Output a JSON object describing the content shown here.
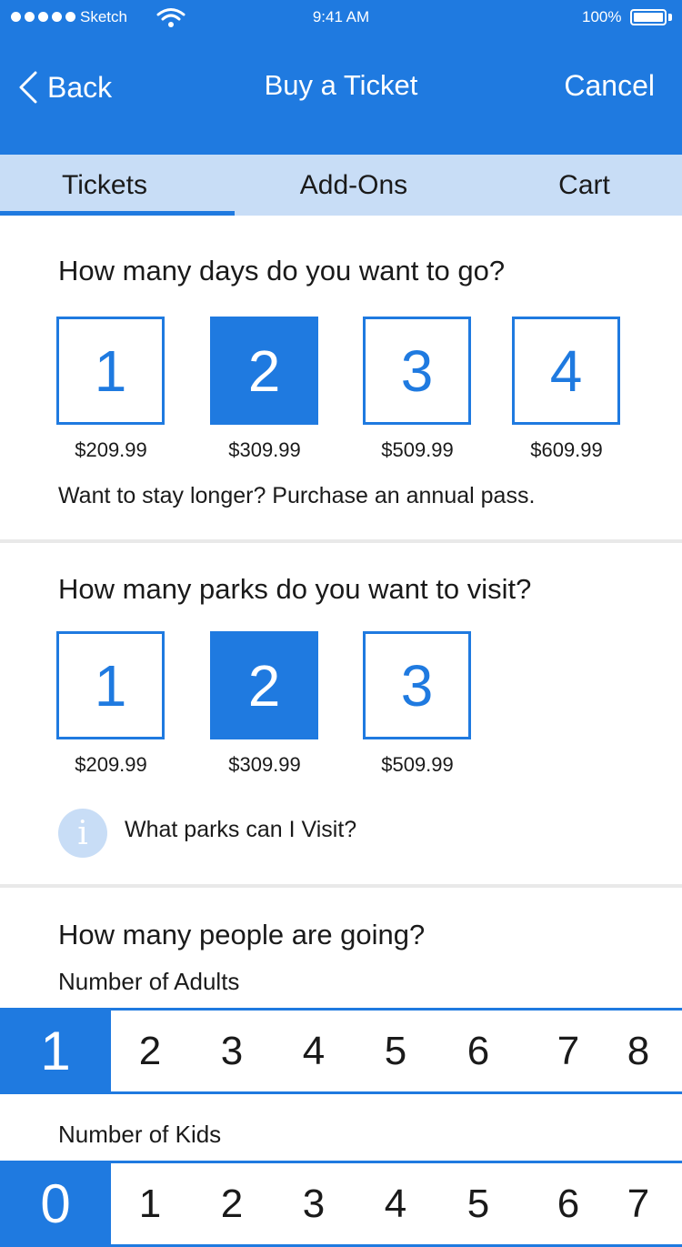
{
  "status": {
    "carrier": "Sketch",
    "time": "9:41 AM",
    "battery": "100%",
    "battery_level": 1.0,
    "signal_bars": 5,
    "icons": [
      "signal-dots-icon",
      "wifi-icon",
      "battery-icon"
    ]
  },
  "nav": {
    "back_label": "Back",
    "title": "Buy a Ticket",
    "cancel_label": "Cancel",
    "back_icon": "chevron-left-icon"
  },
  "tabs": [
    {
      "label": "Tickets",
      "active": true
    },
    {
      "label": "Add-Ons",
      "active": false
    },
    {
      "label": "Cart",
      "active": false
    }
  ],
  "days": {
    "question": "How many days do you want to go?",
    "options": [
      {
        "label": "1",
        "price": "$209.99",
        "selected": false
      },
      {
        "label": "2",
        "price": "$309.99",
        "selected": true
      },
      {
        "label": "3",
        "price": "$509.99",
        "selected": false
      },
      {
        "label": "4",
        "price": "$609.99",
        "selected": false
      }
    ],
    "note": "Want to stay longer? Purchase an annual pass."
  },
  "parks": {
    "question": "How many parks do you want to visit?",
    "options": [
      {
        "label": "1",
        "price": "$209.99",
        "selected": false
      },
      {
        "label": "2",
        "price": "$309.99",
        "selected": true
      },
      {
        "label": "3",
        "price": "$509.99",
        "selected": false
      }
    ],
    "info_icon_glyph": "i",
    "info_link": "What parks can I Visit?"
  },
  "people": {
    "question": "How many people are going?",
    "adults_label": "Number of Adults",
    "adults": [
      "1",
      "2",
      "3",
      "4",
      "5",
      "6",
      "7",
      "8"
    ],
    "adults_selected": "1",
    "kids_label": "Number of Kids",
    "kids": [
      "0",
      "1",
      "2",
      "3",
      "4",
      "5",
      "6",
      "7"
    ],
    "kids_selected": "0"
  },
  "colors": {
    "accent": "#1f7ae0",
    "tab_bar": "#c8ddf6",
    "divider": "#e9e9e9"
  }
}
